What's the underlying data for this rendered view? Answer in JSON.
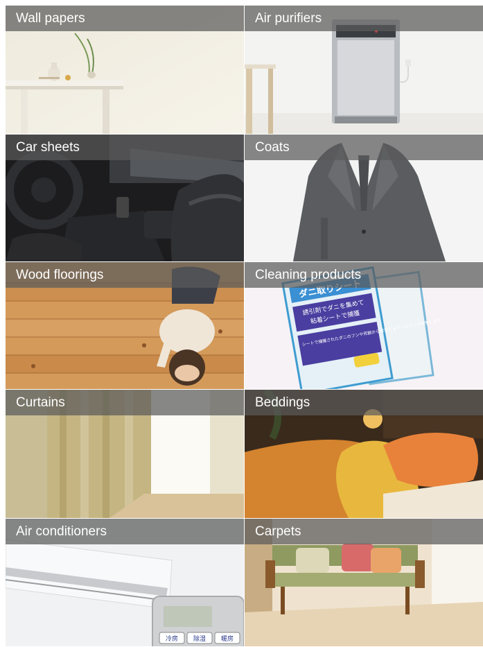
{
  "tiles": [
    {
      "label": "Wall papers",
      "image": "white-wall-table-vase"
    },
    {
      "label": "Air purifiers",
      "image": "air-purifier-appliance"
    },
    {
      "label": "Car sheets",
      "image": "car-interior-leather-seats"
    },
    {
      "label": "Coats",
      "image": "man-in-grey-coat"
    },
    {
      "label": "Wood floorings",
      "image": "baby-on-wood-floor"
    },
    {
      "label": "Cleaning products",
      "image": "mite-sheet-package"
    },
    {
      "label": "Curtains",
      "image": "window-curtains"
    },
    {
      "label": "Beddings",
      "image": "bed-with-pillows"
    },
    {
      "label": "Air conditioners",
      "image": "air-conditioner-remote"
    },
    {
      "label": "Carpets",
      "image": "sofa-on-carpet"
    }
  ],
  "package": {
    "title": "ダニ取りシート",
    "line1": "誘引剤でダニを集めて",
    "line2": "粘着シートで捕獲",
    "line3": "シートで捕獲されたダニのフンや死骸から発生するアレルゲンも抑制します"
  },
  "remote": {
    "buttons": [
      "冷房",
      "除湿",
      "暖房"
    ]
  }
}
